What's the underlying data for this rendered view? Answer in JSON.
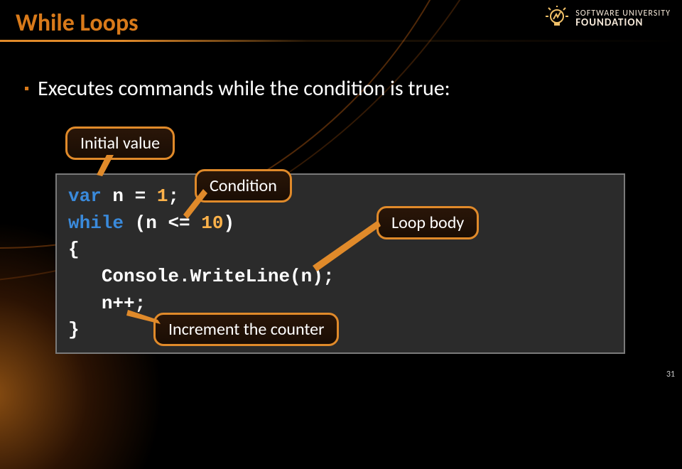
{
  "title": "While Loops",
  "logo": {
    "line1": "SOFTWARE UNIVERSITY",
    "line2": "FOUNDATION"
  },
  "bullet": "Executes commands while the condition is true:",
  "callouts": {
    "initial": "Initial value",
    "condition": "Condition",
    "body": "Loop body",
    "increment": "Increment the counter"
  },
  "code": {
    "l1_kw": "var",
    "l1_var": " n ",
    "l1_eq": "= ",
    "l1_val": "1",
    "l1_semi": ";",
    "l2_kw": "while",
    "l2_open": " (",
    "l2_var": "n",
    "l2_op": " <= ",
    "l2_num": "10",
    "l2_close": ")",
    "l3": "{",
    "l4_indent": "   ",
    "l4_call": "Console.WriteLine(n);",
    "l5_indent": "   ",
    "l5_stmt": "n++;",
    "l6": "}"
  },
  "page": "31"
}
